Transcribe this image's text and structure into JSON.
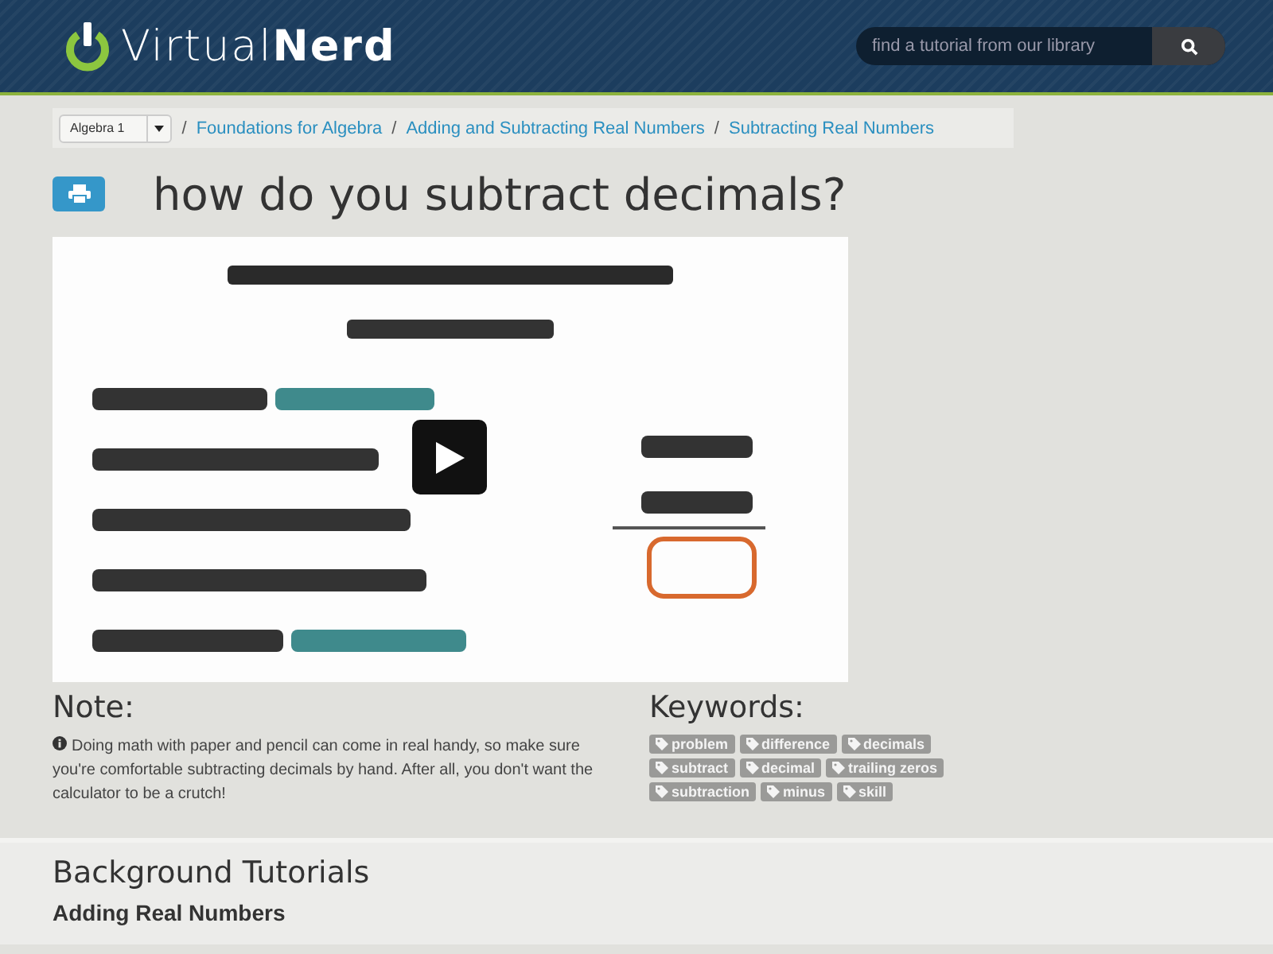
{
  "header": {
    "logo": {
      "light": "Virtual",
      "bold": "Nerd"
    },
    "search": {
      "placeholder": "find a tutorial from our library"
    }
  },
  "breadcrumb": {
    "select": "Algebra 1",
    "links": [
      {
        "separator": "/",
        "label": "Foundations for Algebra"
      },
      {
        "separator": "/",
        "label": "Adding and Subtracting Real Numbers"
      },
      {
        "separator": "/",
        "label": "Subtracting Real Numbers"
      }
    ]
  },
  "title": "how do you subtract decimals?",
  "note": {
    "heading": "Note:",
    "text": "Doing math with paper and pencil can come in real handy, so make sure you're comfortable subtracting decimals by hand. After all, you don't want the calculator to be a crutch!"
  },
  "keywords": {
    "heading": "Keywords:",
    "tags": [
      "problem",
      "difference",
      "decimals",
      "subtract",
      "decimal",
      "trailing zeros",
      "subtraction",
      "minus",
      "skill"
    ]
  },
  "background_tutorials": {
    "heading": "Background Tutorials",
    "items": [
      "Adding Real Numbers"
    ]
  }
}
